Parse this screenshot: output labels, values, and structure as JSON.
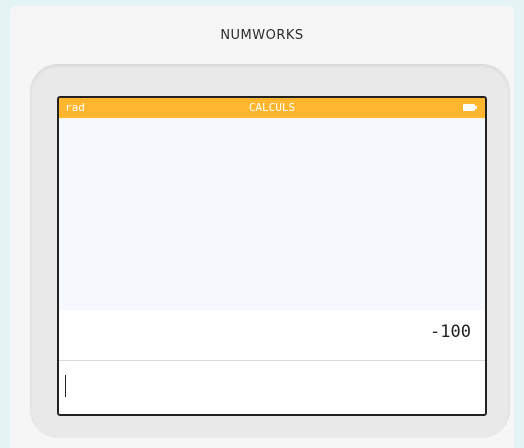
{
  "device": {
    "brand": "NUMWORKS"
  },
  "statusbar": {
    "angle_mode": "rad",
    "app_title": "CALCULS",
    "battery_icon": "battery-icon"
  },
  "calculation": {
    "result": "-100",
    "input_value": ""
  }
}
